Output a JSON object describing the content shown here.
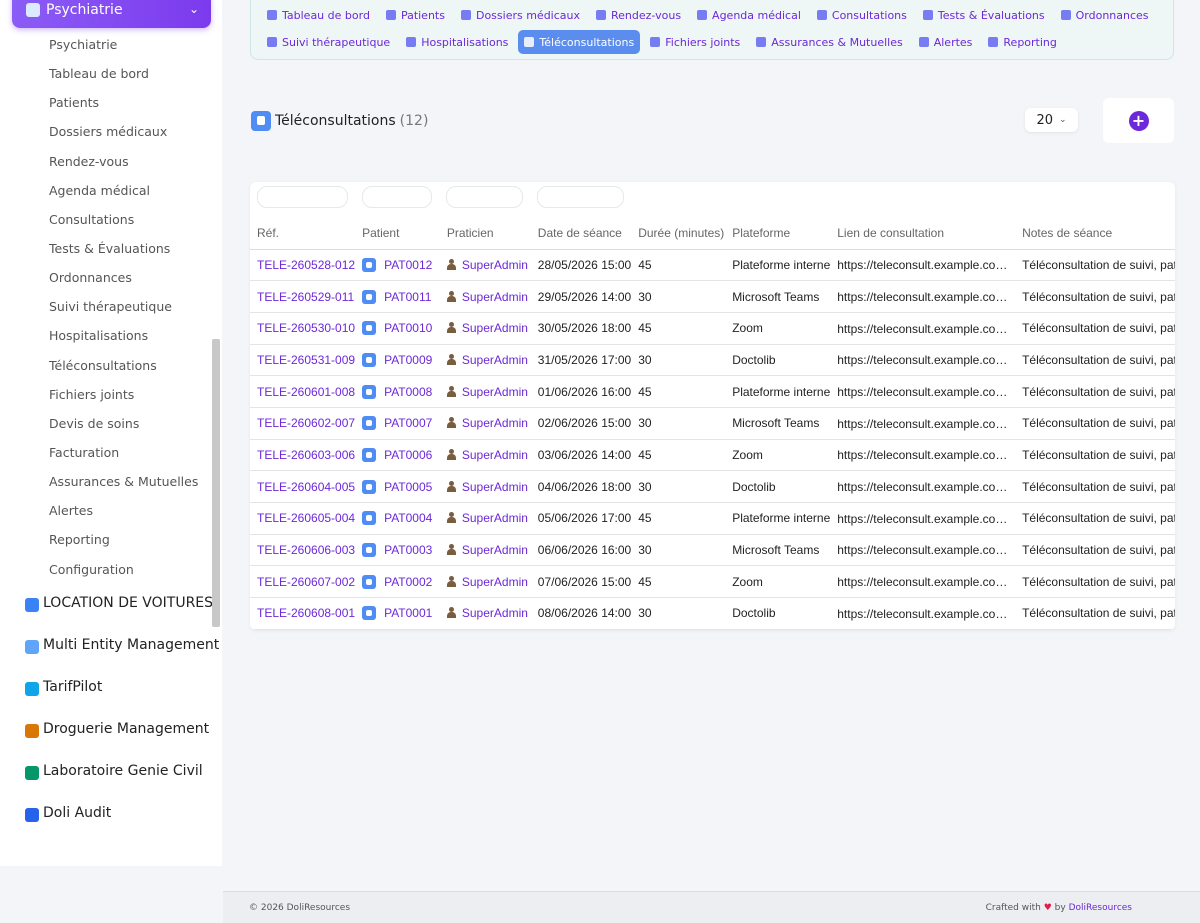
{
  "sidebar": {
    "module": {
      "label": "Psychiatrie"
    },
    "items": [
      "Psychiatrie",
      "Tableau de bord",
      "Patients",
      "Dossiers médicaux",
      "Rendez-vous",
      "Agenda médical",
      "Consultations",
      "Tests & Évaluations",
      "Ordonnances",
      "Suivi thérapeutique",
      "Hospitalisations",
      "Téléconsultations",
      "Fichiers joints",
      "Devis de soins",
      "Facturation",
      "Assurances & Mutuelles",
      "Alertes",
      "Reporting",
      "Configuration"
    ],
    "other_modules": [
      {
        "label": "LOCATION DE VOITURES",
        "color": "#3b82f6"
      },
      {
        "label": "Multi Entity Management",
        "color": "#60a5fa"
      },
      {
        "label": "TarifPilot",
        "color": "#0ea5e9"
      },
      {
        "label": "Droguerie Management",
        "color": "#d97706"
      },
      {
        "label": "Laboratoire Genie Civil",
        "color": "#059669"
      },
      {
        "label": "Doli Audit",
        "color": "#2563eb"
      }
    ]
  },
  "topnav": {
    "row1": [
      "Tableau de bord",
      "Patients",
      "Dossiers médicaux",
      "Rendez-vous",
      "Agenda médical",
      "Consultations",
      "Tests & Évaluations",
      "Ordonnances"
    ],
    "row2": [
      "Suivi thérapeutique",
      "Hospitalisations",
      "Téléconsultations",
      "Fichiers joints",
      "Assurances & Mutuelles",
      "Alertes",
      "Reporting"
    ],
    "active": "Téléconsultations"
  },
  "page": {
    "title": "Téléconsultations",
    "count": "(12)",
    "page_size": "20"
  },
  "table": {
    "headers": [
      "Réf.",
      "Patient",
      "Praticien",
      "Date de séance",
      "Durée (minutes)",
      "Plateforme",
      "Lien de consultation",
      "Notes de séance"
    ],
    "rows": [
      [
        "TELE-260528-012",
        "PAT0012",
        "SuperAdmin",
        "28/05/2026 15:00",
        "45",
        "Plateforme interne",
        "https://teleconsult.example.com/...",
        "Téléconsultation de suivi, patie"
      ],
      [
        "TELE-260529-011",
        "PAT0011",
        "SuperAdmin",
        "29/05/2026 14:00",
        "30",
        "Microsoft Teams",
        "https://teleconsult.example.com/...",
        "Téléconsultation de suivi, patie"
      ],
      [
        "TELE-260530-010",
        "PAT0010",
        "SuperAdmin",
        "30/05/2026 18:00",
        "45",
        "Zoom",
        "https://teleconsult.example.com/...",
        "Téléconsultation de suivi, patie"
      ],
      [
        "TELE-260531-009",
        "PAT0009",
        "SuperAdmin",
        "31/05/2026 17:00",
        "30",
        "Doctolib",
        "https://teleconsult.example.com/...",
        "Téléconsultation de suivi, patie"
      ],
      [
        "TELE-260601-008",
        "PAT0008",
        "SuperAdmin",
        "01/06/2026 16:00",
        "45",
        "Plateforme interne",
        "https://teleconsult.example.com/...",
        "Téléconsultation de suivi, patie"
      ],
      [
        "TELE-260602-007",
        "PAT0007",
        "SuperAdmin",
        "02/06/2026 15:00",
        "30",
        "Microsoft Teams",
        "https://teleconsult.example.com/...",
        "Téléconsultation de suivi, patie"
      ],
      [
        "TELE-260603-006",
        "PAT0006",
        "SuperAdmin",
        "03/06/2026 14:00",
        "45",
        "Zoom",
        "https://teleconsult.example.com/...",
        "Téléconsultation de suivi, patie"
      ],
      [
        "TELE-260604-005",
        "PAT0005",
        "SuperAdmin",
        "04/06/2026 18:00",
        "30",
        "Doctolib",
        "https://teleconsult.example.com/...",
        "Téléconsultation de suivi, patie"
      ],
      [
        "TELE-260605-004",
        "PAT0004",
        "SuperAdmin",
        "05/06/2026 17:00",
        "45",
        "Plateforme interne",
        "https://teleconsult.example.com/...",
        "Téléconsultation de suivi, patie"
      ],
      [
        "TELE-260606-003",
        "PAT0003",
        "SuperAdmin",
        "06/06/2026 16:00",
        "30",
        "Microsoft Teams",
        "https://teleconsult.example.com/...",
        "Téléconsultation de suivi, patie"
      ],
      [
        "TELE-260607-002",
        "PAT0002",
        "SuperAdmin",
        "07/06/2026 15:00",
        "45",
        "Zoom",
        "https://teleconsult.example.com/...",
        "Téléconsultation de suivi, patie"
      ],
      [
        "TELE-260608-001",
        "PAT0001",
        "SuperAdmin",
        "08/06/2026 14:00",
        "30",
        "Doctolib",
        "https://teleconsult.example.com/...",
        "Téléconsultation de suivi, patie"
      ]
    ]
  },
  "footer": {
    "copyright": "© 2026 DoliResources",
    "crafted_prefix": "Crafted with",
    "heart": "♥",
    "crafted_by": "by",
    "brand": "DoliResources"
  },
  "colors": {
    "accent": "#6d28d9",
    "active_tab": "#5b8def",
    "module_header": "#7c3aed"
  }
}
